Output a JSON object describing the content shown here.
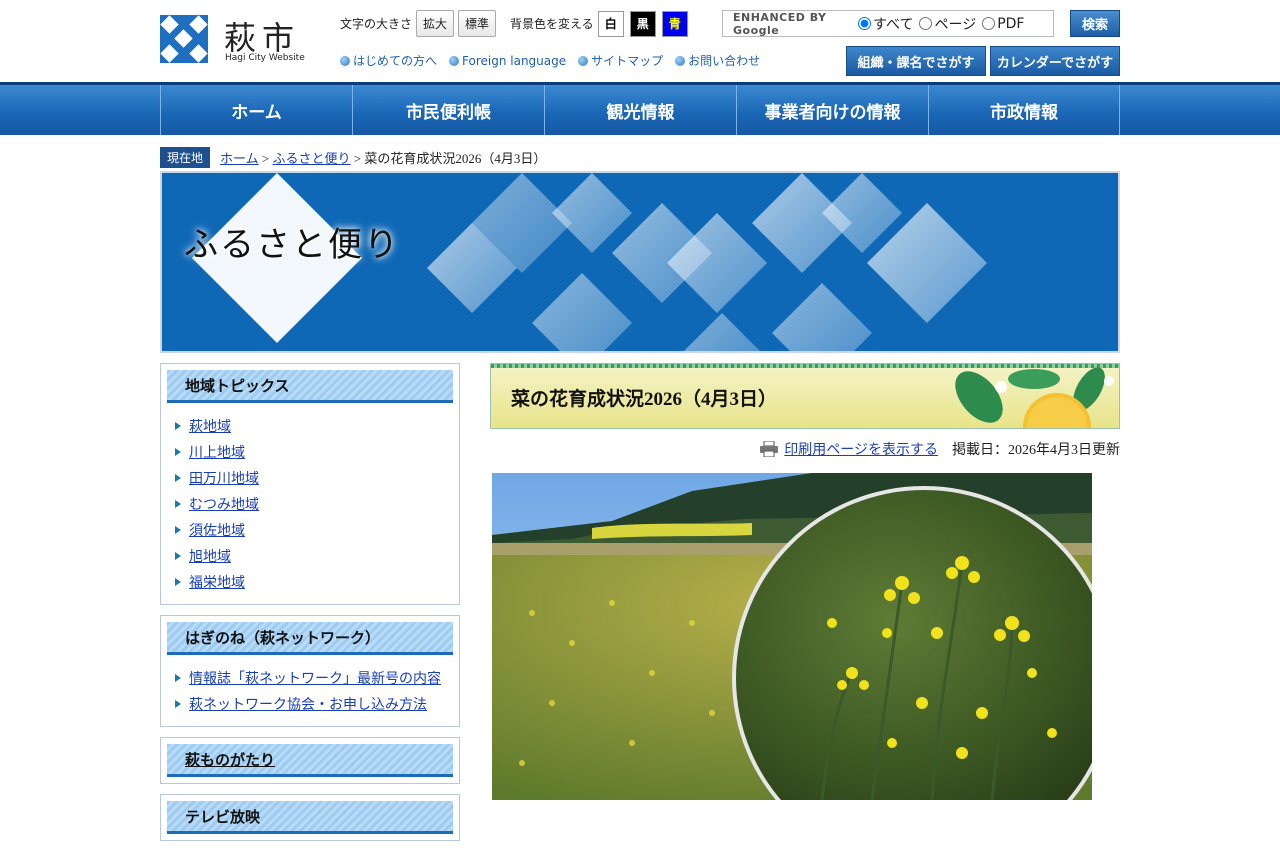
{
  "header": {
    "logo_text": "萩市",
    "logo_sub": "Hagi City Website",
    "font_size_label": "文字の大きさ",
    "font_large": "拡大",
    "font_standard": "標準",
    "bg_label": "背景色を変える",
    "bg_white": "白",
    "bg_black": "黒",
    "bg_blue": "青",
    "links": [
      "はじめての方へ",
      "Foreign language",
      "サイトマップ",
      "お問い合わせ"
    ],
    "search": {
      "google_label": "ENHANCED BY Google",
      "options": [
        "すべて",
        "ページ",
        "PDF"
      ],
      "button": "検索"
    },
    "org_button": "組織・課名でさがす",
    "calendar_button": "カレンダーでさがす"
  },
  "nav": [
    "ホーム",
    "市民便利帳",
    "観光情報",
    "事業者向けの情報",
    "市政情報"
  ],
  "breadcrumb": {
    "label": "現在地",
    "home": "ホーム",
    "section": "ふるさと便り",
    "current": "菜の花育成状況2026（4月3日）"
  },
  "banner": {
    "title": "ふるさと便り"
  },
  "sidebar": [
    {
      "heading": "地域トピックス",
      "items": [
        "萩地域",
        "川上地域",
        "田万川地域",
        "むつみ地域",
        "須佐地域",
        "旭地域",
        "福栄地域"
      ]
    },
    {
      "heading": "はぎのね（萩ネットワーク）",
      "items": [
        "情報誌「萩ネットワーク」最新号の内容",
        "萩ネットワーク協会・お申し込み方法"
      ]
    },
    {
      "heading": "萩ものがたり",
      "items": []
    },
    {
      "heading": "テレビ放映",
      "items": []
    }
  ],
  "main": {
    "title": "菜の花育成状況2026（4月3日）",
    "print_link": "印刷用ページを表示する",
    "posted": "掲載日：2026年4月3日更新"
  },
  "colors": {
    "brand_blue": "#1e6fbf",
    "nav_blue": "#1b67b7",
    "link": "#1a3fb0"
  }
}
